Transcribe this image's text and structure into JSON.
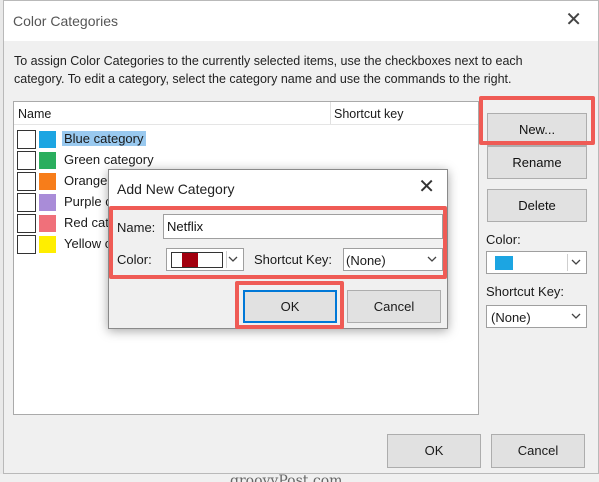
{
  "dialog": {
    "title": "Color Categories",
    "instructions": "To assign Color Categories to the currently selected items, use the checkboxes next to each category.  To edit a category, select the category name and use the commands to the right."
  },
  "list": {
    "headers": {
      "name": "Name",
      "shortcut": "Shortcut key"
    },
    "categories": [
      {
        "label": "Blue category",
        "color": "#1ca5e2",
        "checked": false,
        "selected": true
      },
      {
        "label": "Green category",
        "color": "#2aae5e",
        "checked": false,
        "selected": false
      },
      {
        "label": "Orange",
        "color": "#f77d1a",
        "checked": false,
        "selected": false
      },
      {
        "label": "Purple c",
        "color": "#a98cd8",
        "checked": false,
        "selected": false
      },
      {
        "label": "Red cat",
        "color": "#f0707a",
        "checked": false,
        "selected": false
      },
      {
        "label": "Yellow c",
        "color": "#ffee00",
        "checked": false,
        "selected": false
      }
    ]
  },
  "sidebar": {
    "new_label": "New...",
    "rename_label": "Rename",
    "delete_label": "Delete",
    "color_label": "Color:",
    "color_value": "#1ca5e2",
    "shortcut_label": "Shortcut Key:",
    "shortcut_value": "(None)"
  },
  "footer": {
    "ok_label": "OK",
    "cancel_label": "Cancel"
  },
  "modal": {
    "title": "Add New Category",
    "name_label": "Name:",
    "name_value": "Netflix",
    "color_label": "Color:",
    "color_value": "#a3000f",
    "shortcut_label": "Shortcut Key:",
    "shortcut_value": "(None)",
    "ok_label": "OK",
    "cancel_label": "Cancel"
  },
  "watermark": "groovyPost.com",
  "colors": {
    "highlight": "#ef5b55",
    "selection": "#99c9ef",
    "default_button": "#0078d7"
  }
}
